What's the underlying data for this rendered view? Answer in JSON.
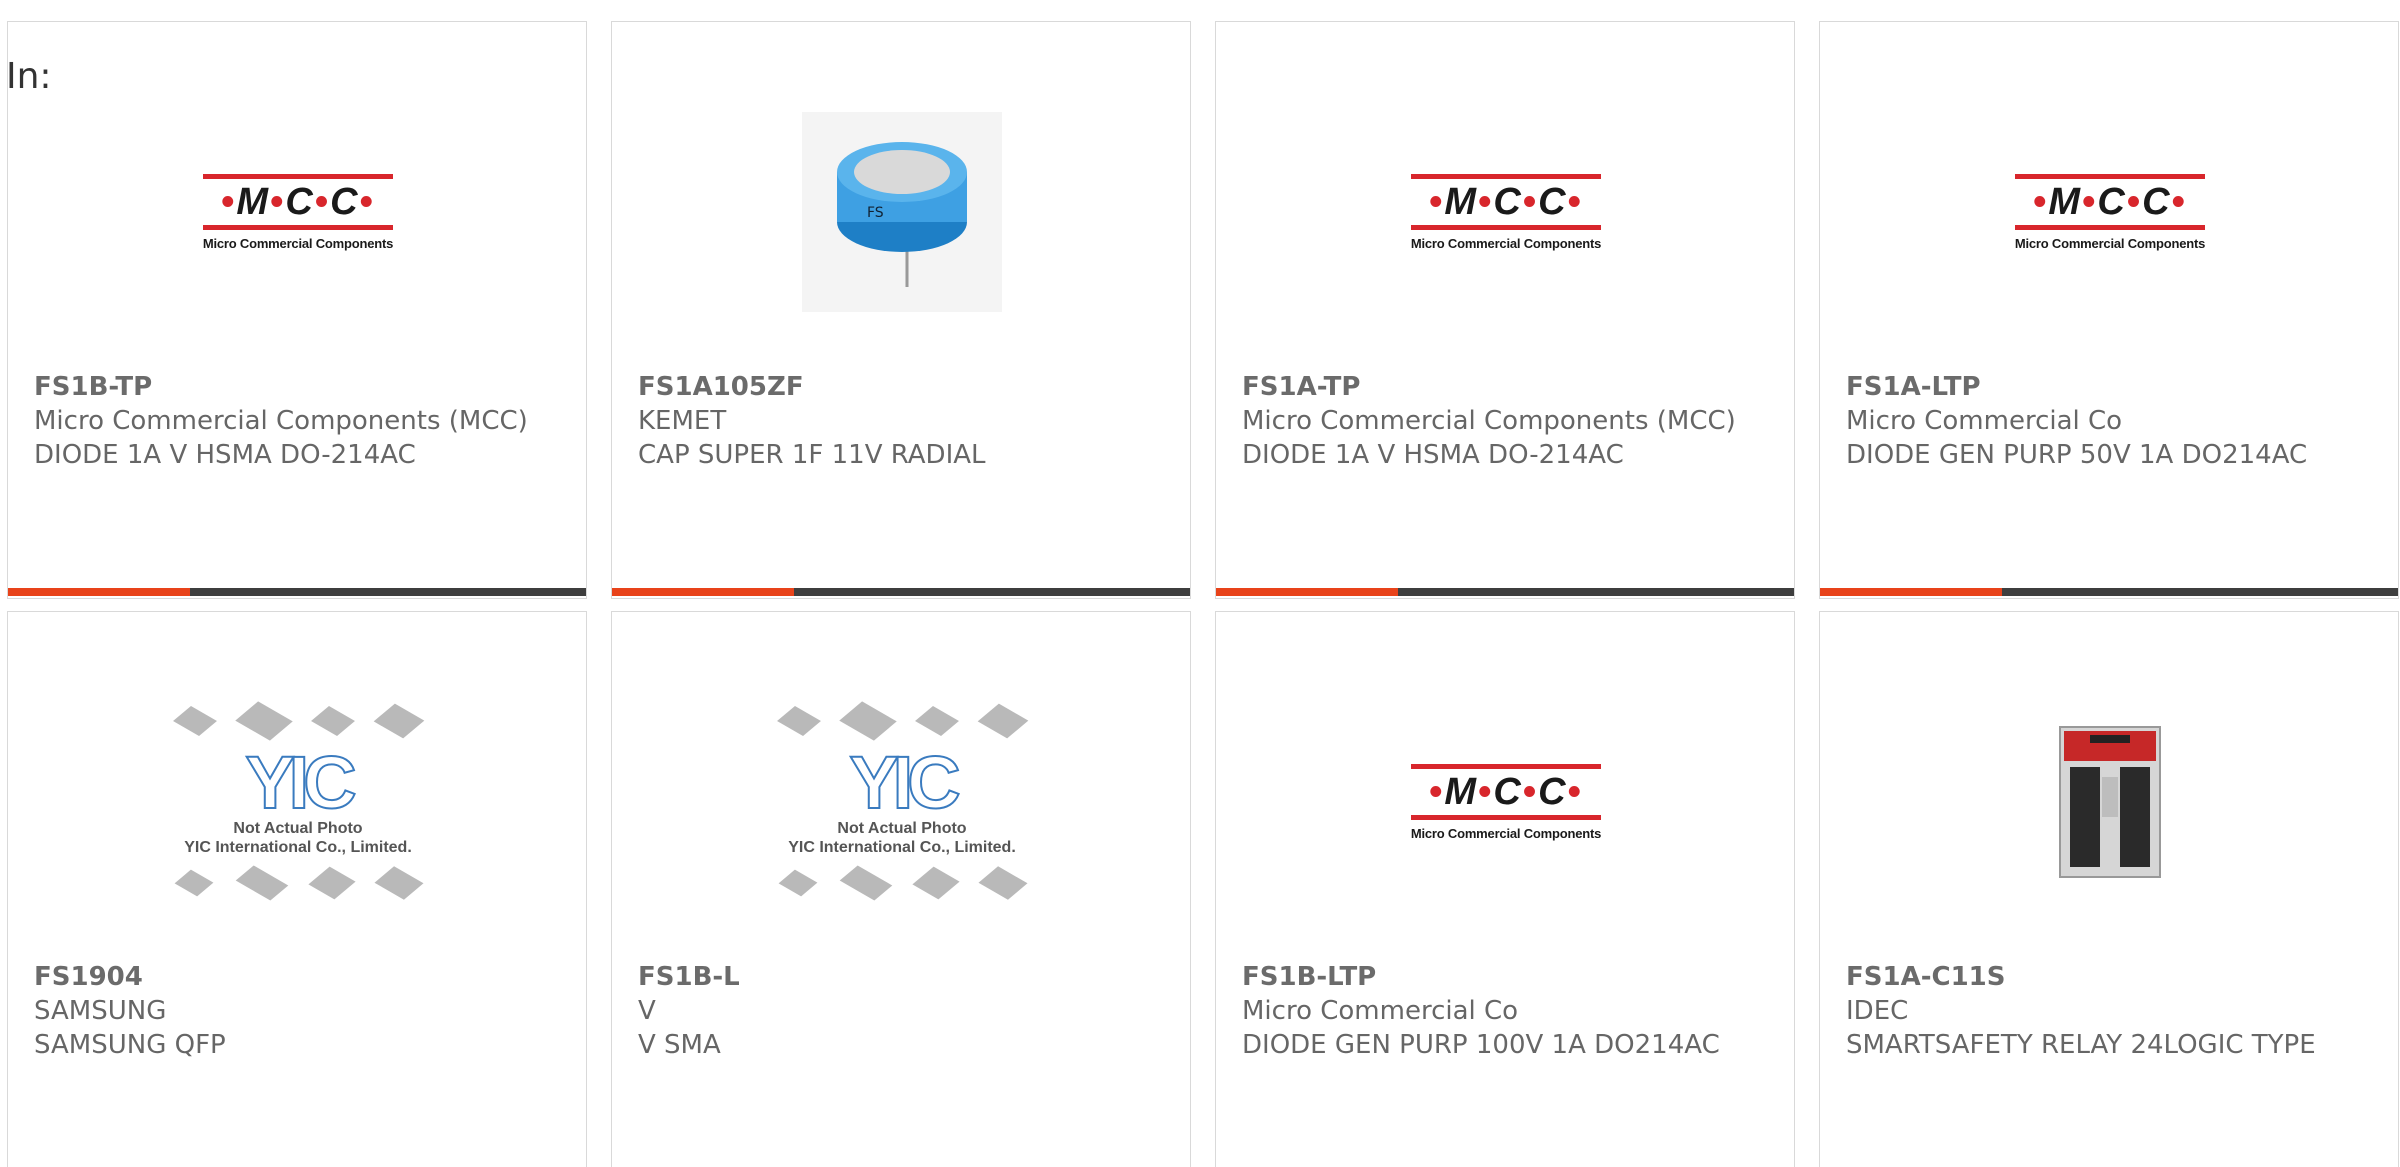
{
  "filter": {
    "label": "In:"
  },
  "logo_text": {
    "mcc_mark": "M C C",
    "mcc_sub": "Micro Commercial Components",
    "yic_logo": "YIC",
    "yic_line1": "Not Actual Photo",
    "yic_line2": "YIC International Co., Limited."
  },
  "products": [
    {
      "part": "FS1B-TP",
      "manufacturer": "Micro Commercial Components (MCC)",
      "description": "DIODE 1A V HSMA DO-214AC",
      "image": "mcc-logo"
    },
    {
      "part": "FS1A105ZF",
      "manufacturer": "KEMET",
      "description": "CAP SUPER 1F 11V RADIAL",
      "image": "capacitor-photo"
    },
    {
      "part": "FS1A-TP",
      "manufacturer": "Micro Commercial Components (MCC)",
      "description": "DIODE 1A V HSMA DO-214AC",
      "image": "mcc-logo"
    },
    {
      "part": "FS1A-LTP",
      "manufacturer": "Micro Commercial Co",
      "description": "DIODE GEN PURP 50V 1A DO214AC",
      "image": "mcc-logo"
    },
    {
      "part": "FS1904",
      "manufacturer": "SAMSUNG",
      "description": "SAMSUNG QFP",
      "image": "yic-placeholder"
    },
    {
      "part": "FS1B-L",
      "manufacturer": "V",
      "description": "V SMA",
      "image": "yic-placeholder"
    },
    {
      "part": "FS1B-LTP",
      "manufacturer": "Micro Commercial Co",
      "description": "DIODE GEN PURP 100V 1A DO214AC",
      "image": "mcc-logo"
    },
    {
      "part": "FS1A-C11S",
      "manufacturer": "IDEC",
      "description": "SMARTSAFETY RELAY 24LOGIC TYPE",
      "image": "relay-photo"
    }
  ],
  "colors": {
    "accent": "#e8431a",
    "bar": "#3e3e3e",
    "border": "#d9d9d9",
    "text": "#666666"
  }
}
